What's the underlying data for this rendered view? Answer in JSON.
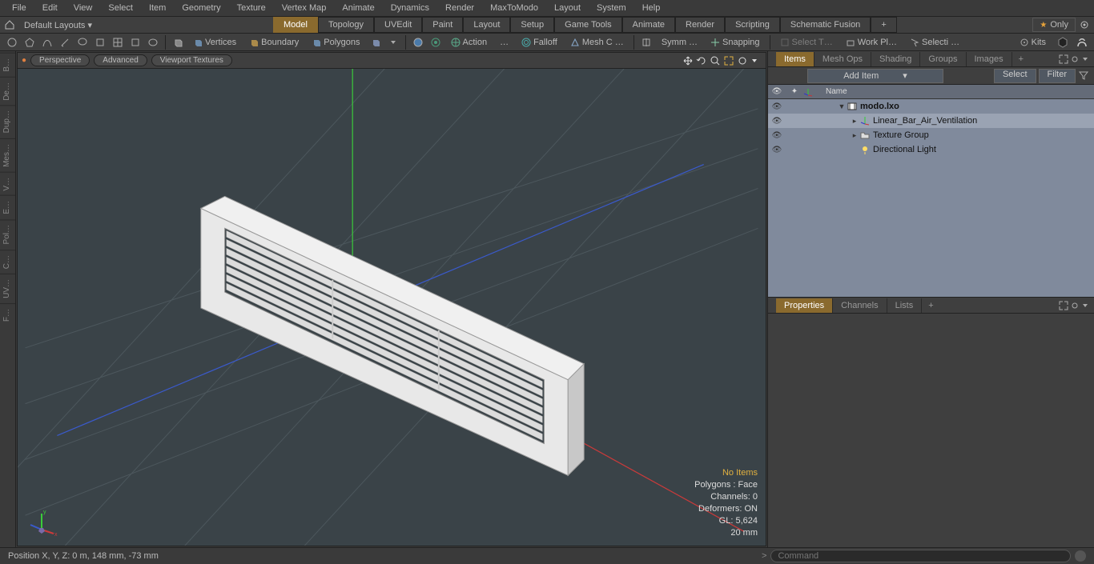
{
  "menubar": [
    "File",
    "Edit",
    "View",
    "Select",
    "Item",
    "Geometry",
    "Texture",
    "Vertex Map",
    "Animate",
    "Dynamics",
    "Render",
    "MaxToModo",
    "Layout",
    "System",
    "Help"
  ],
  "layoutbar": {
    "dropdown": "Default Layouts ▾",
    "tabs": [
      "Model",
      "Topology",
      "UVEdit",
      "Paint",
      "Layout",
      "Setup",
      "Game Tools",
      "Animate",
      "Render",
      "Scripting",
      "Schematic Fusion"
    ],
    "active_tab": "Model",
    "only": "Only"
  },
  "toolbar": {
    "vertices": "Vertices",
    "boundary": "Boundary",
    "polygons": "Polygons",
    "action": "Action",
    "action_ellipsis": "…",
    "falloff": "Falloff",
    "meshc": "Mesh C …",
    "symm": "Symm …",
    "snapping": "Snapping",
    "selectt": "Select T…",
    "workpl": "Work Pl…",
    "selecti": "Selecti …",
    "kits": "Kits"
  },
  "viewport": {
    "dropdowns": [
      "Perspective",
      "Advanced",
      "Viewport Textures"
    ],
    "info": {
      "no_items": "No Items",
      "polygons": "Polygons : Face",
      "channels": "Channels: 0",
      "deformers": "Deformers: ON",
      "gl": "GL: 5,624",
      "size": "20 mm"
    }
  },
  "items_panel": {
    "tabs": [
      "Items",
      "Mesh Ops",
      "Shading",
      "Groups",
      "Images"
    ],
    "active": "Items",
    "add_item": "Add Item",
    "select": "Select",
    "filter": "Filter",
    "header_name": "Name",
    "tree": [
      {
        "type": "scene",
        "label": "modo.lxo",
        "bold": true
      },
      {
        "type": "mesh",
        "label": "Linear_Bar_Air_Ventilation",
        "indent": 2,
        "selected": true
      },
      {
        "type": "group",
        "label": "Texture Group",
        "indent": 2
      },
      {
        "type": "light",
        "label": "Directional Light",
        "indent": 2
      }
    ]
  },
  "props_panel": {
    "tabs": [
      "Properties",
      "Channels",
      "Lists"
    ],
    "active": "Properties"
  },
  "statusbar": {
    "position": "Position X, Y, Z:   0 m,  148 mm,  -73 mm",
    "command_placeholder": "Command"
  }
}
